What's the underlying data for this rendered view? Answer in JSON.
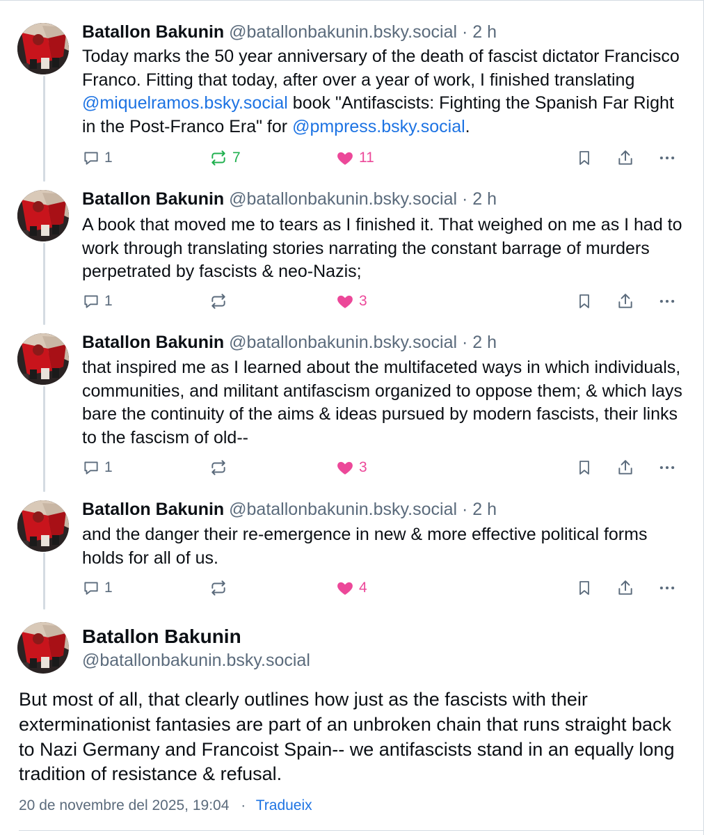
{
  "thread": [
    {
      "name": "Batallon Bakunin",
      "handle": "@batallonbakunin.bsky.social",
      "dot": "·",
      "time": "2 h",
      "body_parts": [
        {
          "text": "Today marks the 50 year anniversary of the death of fascist dictator Francisco Franco. Fitting that today, after over a year of work, I finished translating ",
          "mention": false
        },
        {
          "text": "@miquelramos.bsky.social",
          "mention": true
        },
        {
          "text": " book \"Antifascists: Fighting the Spanish Far Right in the Post-Franco Era\" for ",
          "mention": false
        },
        {
          "text": "@pmpress.bsky.social",
          "mention": true
        },
        {
          "text": ".",
          "mention": false
        }
      ],
      "replies": "1",
      "reposts": "7",
      "reposted": true,
      "likes": "11"
    },
    {
      "name": "Batallon Bakunin",
      "handle": "@batallonbakunin.bsky.social",
      "dot": "·",
      "time": "2 h",
      "body_parts": [
        {
          "text": "A book that moved me to tears as I finished it. That weighed on me as I had to work through translating stories narrating the constant barrage of murders perpetrated by fascists & neo-Nazis;",
          "mention": false
        }
      ],
      "replies": "1",
      "reposts": "",
      "reposted": false,
      "likes": "3"
    },
    {
      "name": "Batallon Bakunin",
      "handle": "@batallonbakunin.bsky.social",
      "dot": "·",
      "time": "2 h",
      "body_parts": [
        {
          "text": "that inspired me as I learned about the multifaceted ways in which individuals, communities, and militant antifascism organized to oppose them; & which lays bare the continuity of the aims & ideas pursued by modern fascists, their links to the fascism of old--",
          "mention": false
        }
      ],
      "replies": "1",
      "reposts": "",
      "reposted": false,
      "likes": "3"
    },
    {
      "name": "Batallon Bakunin",
      "handle": "@batallonbakunin.bsky.social",
      "dot": "·",
      "time": "2 h",
      "body_parts": [
        {
          "text": "and the danger their re-emergence in new & more effective political forms holds for all of us.",
          "mention": false
        }
      ],
      "replies": "1",
      "reposts": "",
      "reposted": false,
      "likes": "4"
    }
  ],
  "main_post": {
    "name": "Batallon Bakunin",
    "handle": "@batallonbakunin.bsky.social",
    "text": "But most of all, that clearly outlines how just as the fascists with their exterminationist fantasies are part of an unbroken chain that runs straight back to Nazi Germany and Francoist Spain-- we antifascists stand in an equally long tradition of resistance & refusal.",
    "date": "20 de novembre del 2025, 19:04",
    "separator": "·",
    "translate_label": "Tradueix"
  },
  "colors": {
    "text": "#0b0f14",
    "muted": "#5b6b7c",
    "mention": "#1d73e3",
    "repost_active": "#20b04f",
    "like": "#ec4899",
    "thread_line": "#d4dbe2"
  },
  "icons": {
    "reply": "speech-bubble-icon",
    "repost": "repost-arrows-icon",
    "like": "heart-icon",
    "bookmark": "bookmark-icon",
    "share": "share-icon",
    "more": "ellipsis-icon",
    "avatar": "avatar-image"
  }
}
